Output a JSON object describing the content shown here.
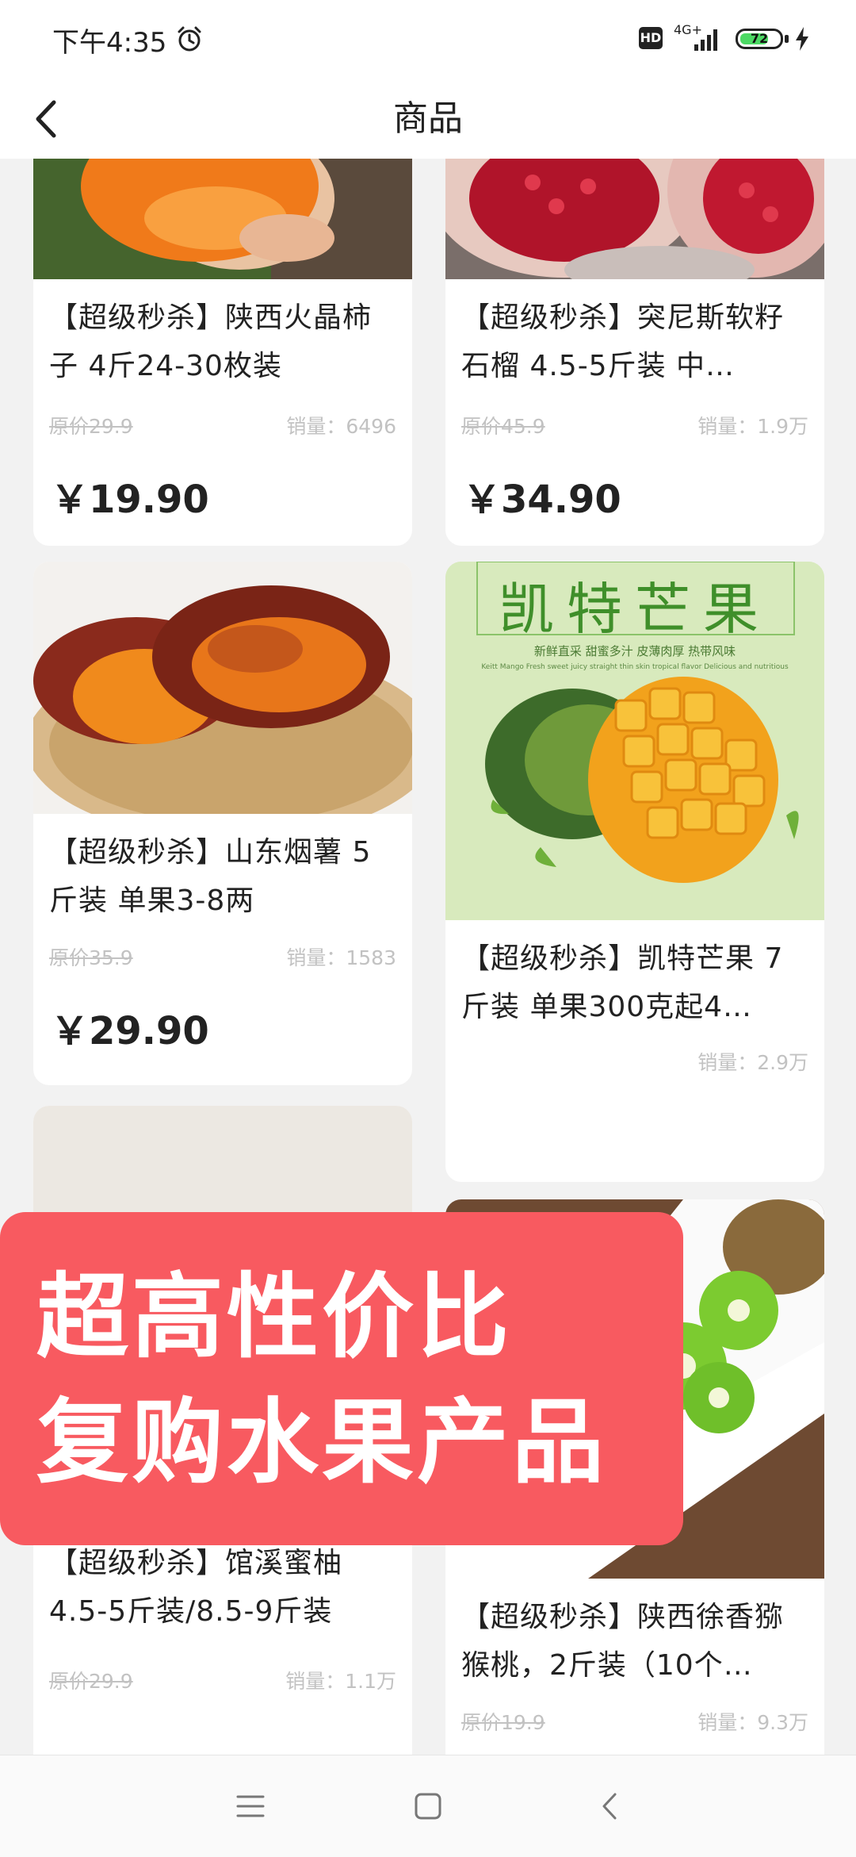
{
  "status_bar": {
    "time": "下午4:35",
    "hd": "HD",
    "network": "4G+",
    "battery_level": 72,
    "battery_text": "72"
  },
  "header": {
    "title": "商品"
  },
  "products": [
    {
      "title": "【超级秒杀】陕西火晶柿子 4斤24-30枚装",
      "original_price": "原价29.9",
      "sales": "销量：6496",
      "price": "￥19.90"
    },
    {
      "title": "【超级秒杀】突尼斯软籽石榴 4.5-5斤装 中…",
      "original_price": "原价45.9",
      "sales": "销量：1.9万",
      "price": "￥34.90"
    },
    {
      "title": "【超级秒杀】山东烟薯 5斤装 单果3-8两",
      "original_price": "原价35.9",
      "sales": "销量：1583",
      "price": "￥29.90"
    },
    {
      "title": "【超级秒杀】凯特芒果 7斤装 单果300克起4…",
      "original_price": "",
      "sales": "销量：2.9万",
      "price": "",
      "image_title": "凯特芒果",
      "image_subtitle": "新鲜直采  甜蜜多汁  皮薄肉厚  热带风味",
      "image_caption": "Keitt Mango Fresh sweet juicy straight thin skin tropical flavor Delicious and nutritious"
    },
    {
      "title": "【超级秒杀】馆溪蜜柚 4.5-5斤装/8.5-9斤装",
      "original_price": "原价29.9",
      "sales": "销量：1.1万",
      "price": ""
    },
    {
      "title": "【超级秒杀】陕西徐香猕猴桃，2斤装（10个…",
      "original_price": "原价19.9",
      "sales": "销量：9.3万",
      "price": ""
    }
  ],
  "promo": {
    "line1": "超高性价比",
    "line2": "复购水果产品"
  },
  "colors": {
    "accent": "#f85a60",
    "price": "#222222",
    "muted": "#c2c2c2",
    "background": "#f2f2f2"
  },
  "icons": [
    "alarm-icon",
    "signal-icon",
    "battery-icon",
    "charging-icon",
    "back-arrow-icon",
    "menu-icon",
    "home-icon",
    "back-icon"
  ]
}
